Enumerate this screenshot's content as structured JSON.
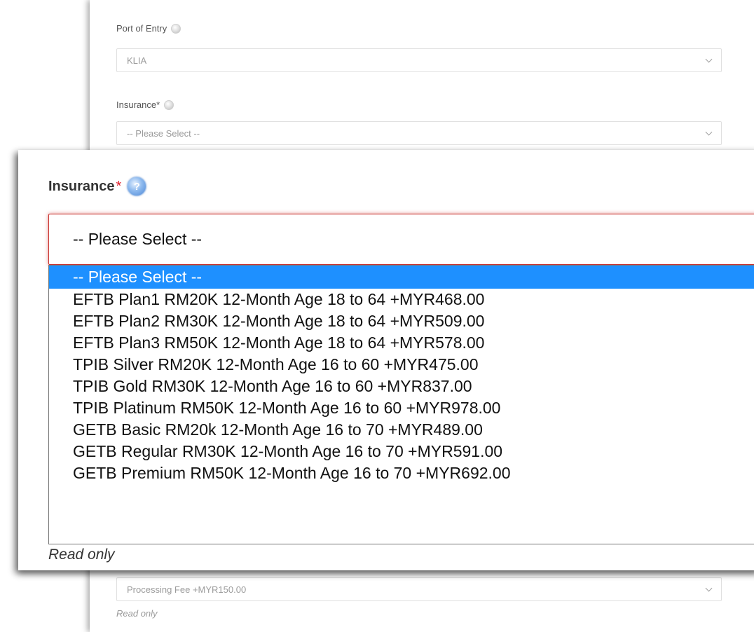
{
  "form": {
    "port_of_entry": {
      "label": "Port of Entry",
      "value": "KLIA"
    },
    "insurance": {
      "label": "Insurance",
      "required_mark": "*",
      "value": "-- Please Select --"
    },
    "processing_fee": {
      "value": "Processing Fee +MYR150.00",
      "note": "Read only"
    }
  },
  "zoom": {
    "label": "Insurance",
    "required_mark": "*",
    "help_glyph": "?",
    "help_icon": "question-circle-icon",
    "selected_value": "-- Please Select --",
    "options": [
      "-- Please Select --",
      "EFTB Plan1 RM20K 12-Month Age 18 to 64 +MYR468.00",
      "EFTB Plan2 RM30K 12-Month Age 18 to 64 +MYR509.00",
      "EFTB Plan3 RM50K 12-Month Age 18 to 64 +MYR578.00",
      "TPIB Silver RM20K 12-Month Age 16 to 60 +MYR475.00",
      "TPIB Gold RM30K 12-Month Age 16 to 60 +MYR837.00",
      "TPIB Platinum RM50K 12-Month Age 16 to 60 +MYR978.00",
      "GETB Basic RM20k 12-Month Age 16 to 70 +MYR489.00",
      "GETB Regular RM30K 12-Month Age 16 to 70 +MYR591.00",
      "GETB Premium RM50K 12-Month Age 16 to 70 +MYR692.00"
    ],
    "readonly_note": "Read only"
  },
  "colors": {
    "highlight": "#1e90ff",
    "error_border": "#c9302c",
    "required": "#e0212e"
  }
}
